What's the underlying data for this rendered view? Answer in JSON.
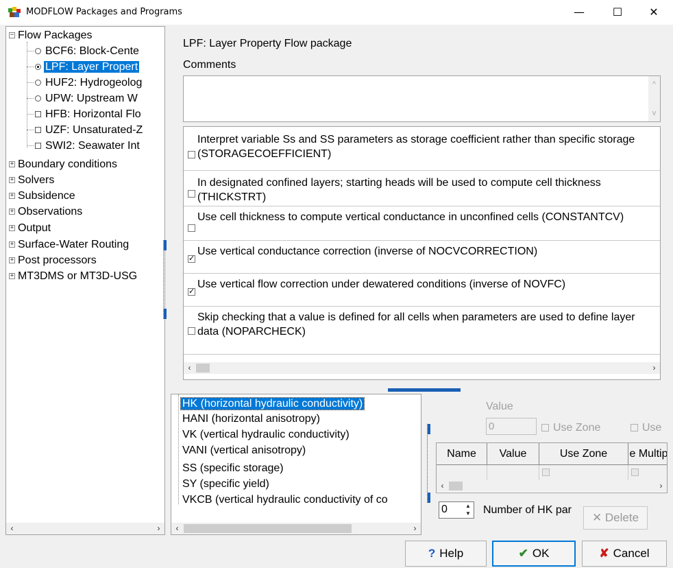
{
  "window": {
    "title": "MODFLOW Packages and Programs",
    "minimize": "—",
    "maximize": "☐",
    "close": "✕"
  },
  "package_tree": {
    "root_items": [
      {
        "label": "Flow Packages",
        "expanded": true
      },
      {
        "label": "Boundary conditions"
      },
      {
        "label": "Solvers"
      },
      {
        "label": "Subsidence"
      },
      {
        "label": "Observations"
      },
      {
        "label": "Output"
      },
      {
        "label": "Surface-Water Routing"
      },
      {
        "label": "Post processors"
      },
      {
        "label": "MT3DMS or MT3D-USG"
      }
    ],
    "flow_children": [
      {
        "label": "BCF6: Block-Cente",
        "control": "radio",
        "selected": false
      },
      {
        "label": "LPF: Layer Propert",
        "control": "radio",
        "selected": true
      },
      {
        "label": "HUF2: Hydrogeolog",
        "control": "radio",
        "selected": false
      },
      {
        "label": "UPW: Upstream W",
        "control": "radio",
        "selected": false
      },
      {
        "label": "HFB: Horizontal Flo",
        "control": "checkbox",
        "selected": false
      },
      {
        "label": "UZF: Unsaturated-Z",
        "control": "checkbox",
        "selected": false
      },
      {
        "label": "SWI2: Seawater Int",
        "control": "checkbox",
        "selected": false
      }
    ]
  },
  "package": {
    "title": "LPF: Layer Property Flow package",
    "comments_label": "Comments",
    "comments_value": ""
  },
  "options": [
    {
      "text": "Interpret variable Ss and SS parameters as storage coefficient rather than specific storage (STORAGECOEFFICIENT)",
      "checked": false
    },
    {
      "text": "In designated confined layers; starting heads will be used to compute cell thickness (THICKSTRT)",
      "checked": false
    },
    {
      "text": "Use cell thickness to compute vertical conductance in unconfined cells (CONSTANTCV)",
      "checked": false
    },
    {
      "text": "Use vertical conductance correction (inverse of NOCVCORRECTION)",
      "checked": true
    },
    {
      "text": "Use vertical flow correction under dewatered conditions (inverse of NOVFC)",
      "checked": true
    },
    {
      "text": "Skip checking that a value is defined for all cells when parameters are used to define layer data (NOPARCHECK)",
      "checked": false
    }
  ],
  "parameters": [
    {
      "label": "HK (horizontal hydraulic conductivity)",
      "selected": true
    },
    {
      "label": "HANI (horizontal anisotropy)"
    },
    {
      "label": "VK (vertical hydraulic conductivity)"
    },
    {
      "label": "VANI (vertical anisotropy)"
    },
    {
      "label": "SS (specific storage)"
    },
    {
      "label": "SY (specific yield)"
    },
    {
      "label": "VKCB (vertical hydraulic conductivity of co"
    }
  ],
  "value_panel": {
    "value_label": "Value",
    "value": "0",
    "use_zone_1": "Use Zone",
    "use_zone_2": "Use"
  },
  "grid": {
    "columns": [
      "Name",
      "Value",
      "Use Zone",
      "e Multip"
    ]
  },
  "num_params": {
    "value": "0",
    "label": "Number of HK par"
  },
  "buttons": {
    "delete": "Delete",
    "help": "Help",
    "ok": "OK",
    "cancel": "Cancel"
  },
  "colors": {
    "selection": "#0078d7",
    "ok_icon": "#2e8b2e",
    "cancel_icon": "#c81e1e",
    "help_icon": "#1a56c8"
  }
}
